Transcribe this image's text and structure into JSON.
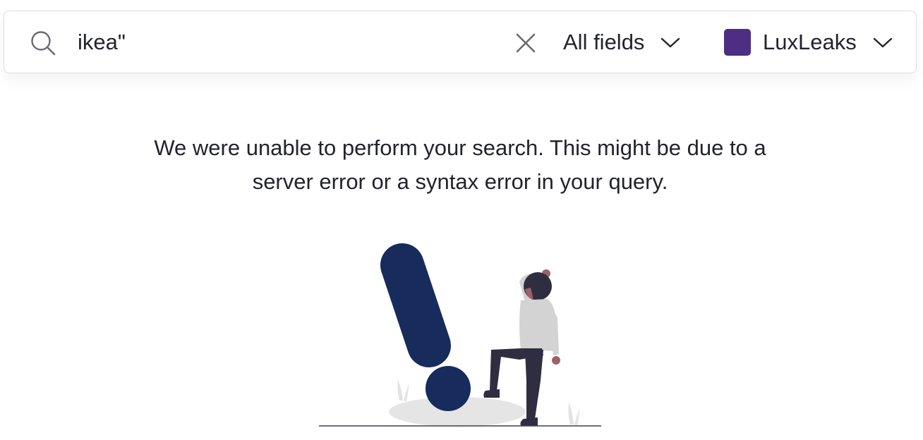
{
  "search": {
    "query": "ikea\"",
    "field_filter": "All fields",
    "collection": {
      "name": "LuxLeaks",
      "color": "#4d2e84"
    }
  },
  "icons": {
    "search": "search-icon",
    "clear": "close-icon",
    "dropdown": "chevron-down-icon"
  },
  "error": {
    "message": "We were unable to perform your search. This might be due to a server error or a syntax error in your query."
  },
  "colors": {
    "exclamation": "#172b5c",
    "text": "#23232f"
  }
}
